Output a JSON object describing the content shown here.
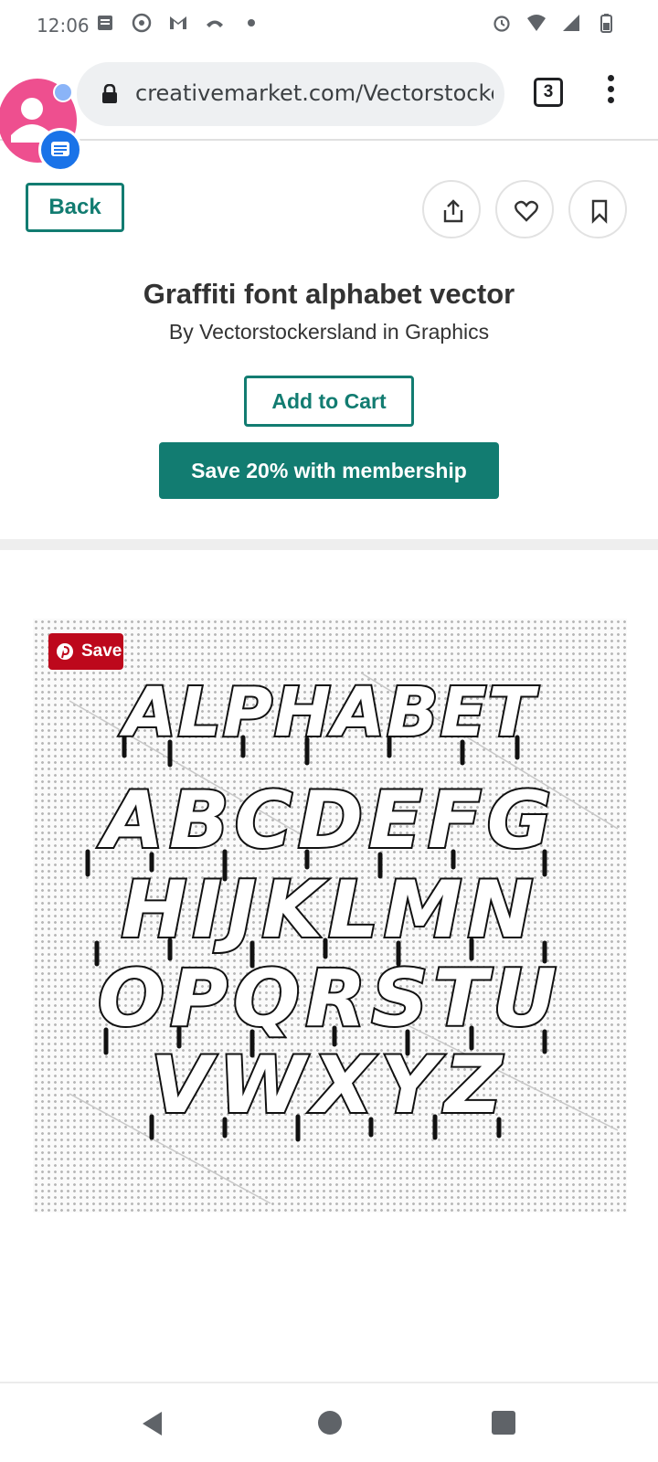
{
  "status_bar": {
    "time": "12:06",
    "left_icons": [
      "notes-icon",
      "data-saver-icon",
      "gmail-icon",
      "missed-call-icon",
      "dot-icon"
    ],
    "right_icons": [
      "alarm-icon",
      "wifi-icon",
      "signal-icon",
      "battery-icon"
    ]
  },
  "browser": {
    "url": "creativemarket.com/Vectorstockersr",
    "tab_count": "3"
  },
  "toolbar": {
    "back_label": "Back",
    "action_icons": [
      "share-icon",
      "heart-icon",
      "bookmark-icon"
    ]
  },
  "product": {
    "title": "Graffiti font alphabet vector",
    "byline": "By Vectorstockersland in Graphics",
    "add_to_cart_label": "Add to Cart",
    "membership_label": "Save 20% with membership"
  },
  "preview": {
    "pin_save_label": "Save",
    "image_heading": "ALPHABET",
    "letter_rows": [
      "ABCDEFG",
      "HIJKLMN",
      "OPQRSTU",
      "VWXYZ"
    ]
  },
  "colors": {
    "accent": "#127c71",
    "pinterest": "#bd081c",
    "chat_head": "#ee4f8f",
    "chat_badge": "#1a73e8"
  },
  "nav_icons": [
    "back-triangle-icon",
    "home-circle-icon",
    "recents-square-icon"
  ]
}
